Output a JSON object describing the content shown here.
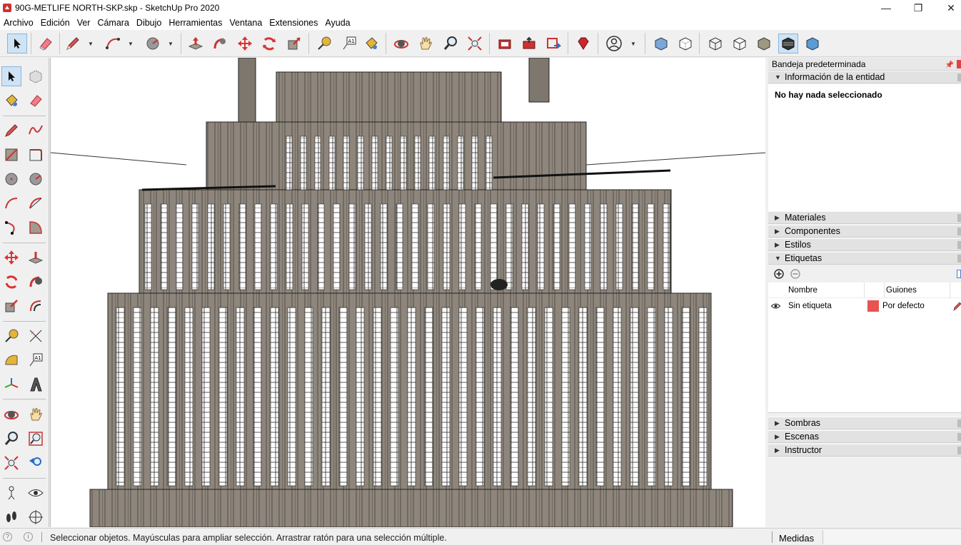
{
  "window": {
    "title": "90G-METLIFE NORTH-SKP.skp - SketchUp Pro 2020",
    "minimize": "—",
    "maximize": "❐",
    "close": "✕"
  },
  "menu": [
    "Archivo",
    "Edición",
    "Ver",
    "Cámara",
    "Dibujo",
    "Herramientas",
    "Ventana",
    "Extensiones",
    "Ayuda"
  ],
  "tray": {
    "title": "Bandeja predeterminada",
    "entity_info": {
      "header": "Información de la entidad",
      "selection": "No hay nada seleccionado"
    },
    "panels": {
      "materials": "Materiales",
      "components": "Componentes",
      "styles": "Estilos",
      "tags": "Etiquetas",
      "shadows": "Sombras",
      "scenes": "Escenas",
      "instructor": "Instructor"
    },
    "tags_table": {
      "col_name": "Nombre",
      "col_dashes": "Guiones",
      "rows": [
        {
          "name": "Sin etiqueta",
          "dash": "Por defecto",
          "color": "#e8534f"
        }
      ]
    }
  },
  "status": {
    "message": "Seleccionar objetos. Mayúsculas para ampliar selección. Arrastrar ratón para una selección múltiple.",
    "measure_label": "Medidas",
    "measure_value": ""
  },
  "colors": {
    "facade": "#8e867c",
    "edge": "#2a2a2a",
    "window": "#ffffff",
    "accent_select": "#cfe3f5"
  }
}
